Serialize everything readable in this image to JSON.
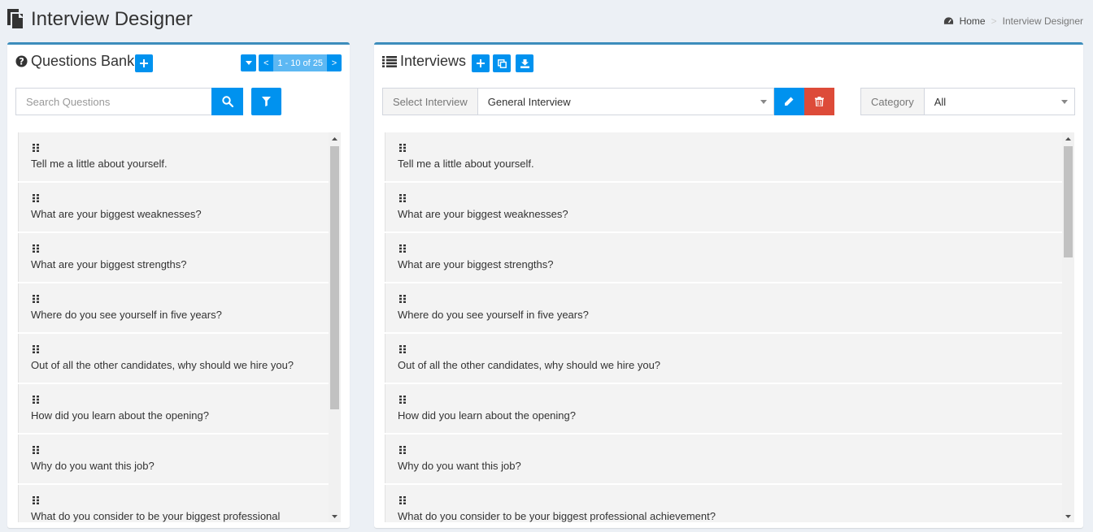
{
  "header": {
    "title": "Interview Designer",
    "icon": "documents-icon"
  },
  "breadcrumb": {
    "home": "Home",
    "separator": ">",
    "current": "Interview Designer"
  },
  "questions_bank": {
    "title": "Questions Bank",
    "pager_label": "1 - 10 of 25",
    "pager_prev": "<",
    "pager_next": ">",
    "search_placeholder": "Search Questions",
    "scroll_position": 0.0,
    "items": [
      "Tell me a little about yourself.",
      "What are your biggest weaknesses?",
      "What are your biggest strengths?",
      "Where do you see yourself in five years?",
      "Out of all the other candidates, why should we hire you?",
      "How did you learn about the opening?",
      "Why do you want this job?",
      "What do you consider to be your biggest professional"
    ]
  },
  "interviews": {
    "title": "Interviews",
    "select_interview_label": "Select Interview",
    "selected_interview": "General Interview",
    "category_label": "Category",
    "selected_category": "All",
    "items": [
      "Tell me a little about yourself.",
      "What are your biggest weaknesses?",
      "What are your biggest strengths?",
      "Where do you see yourself in five years?",
      "Out of all the other candidates, why should we hire you?",
      "How did you learn about the opening?",
      "Why do you want this job?",
      "What do you consider to be your biggest professional achievement?"
    ]
  },
  "colors": {
    "primary": "#0092ef",
    "danger": "#dd4b39",
    "box_border": "#3c8dbc",
    "background": "#ecf0f5"
  }
}
